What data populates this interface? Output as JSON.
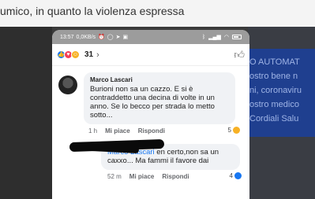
{
  "article": {
    "text": "umico, in quanto la violenza espressa"
  },
  "side_panel": {
    "lines": [
      "O AUTOMAT",
      "ostro bene n",
      "ni, coronaviru",
      "ostro medico",
      "Cordiali Salu"
    ]
  },
  "status_bar": {
    "time": "13:57",
    "speed": "0,0KB/s",
    "icons_left": [
      "alarm-icon",
      "whatsapp-icon",
      "send-icon",
      "image-icon"
    ],
    "icons_right": [
      "bluetooth-icon",
      "signal-icon",
      "wifi-icon",
      "battery-icon"
    ]
  },
  "post": {
    "reaction_count": "31",
    "reaction_types": [
      "like",
      "love",
      "haha"
    ]
  },
  "comment": {
    "author": "Marco Lascari",
    "text": "Burioni non sa un cazzo. E si è contraddetto una decina di volte in un anno. Se lo becco per strada lo metto sotto...",
    "time": "1 h",
    "like_label": "Mi piace",
    "reply_label": "Rispondi",
    "reaction_count": "5"
  },
  "reply": {
    "mention": "Marco Lascari",
    "text": " en certo,non sa un caxxo... Ma fammi il favore dai",
    "time": "52 m",
    "like_label": "Mi piace",
    "reply_label": "Rispondi",
    "reaction_count": "4"
  }
}
